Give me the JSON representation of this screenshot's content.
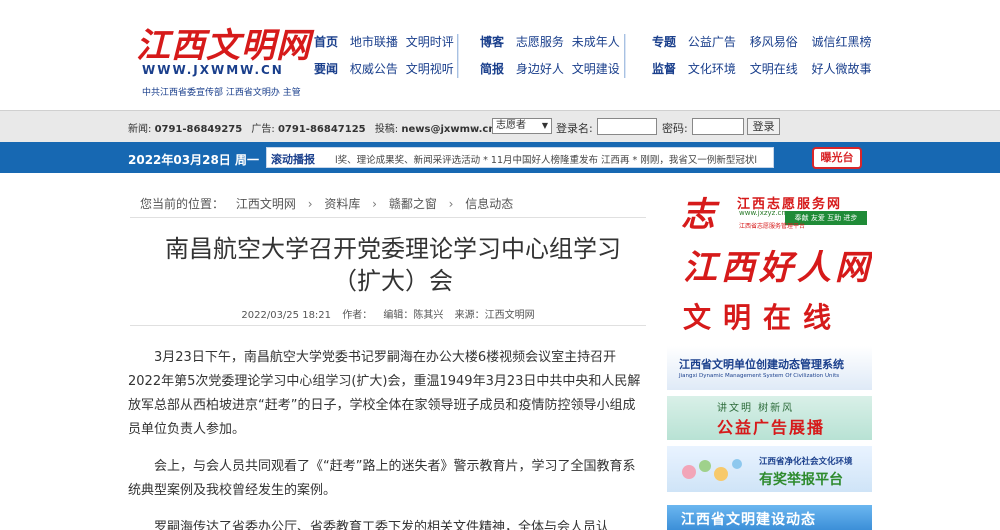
{
  "site": {
    "logo_cn": "江西文明网",
    "logo_en": "WWW.JXWMW.CN",
    "logo_sub": "中共江西省委宣传部  江西省文明办 主管"
  },
  "nav": {
    "group1": {
      "row1": {
        "head": "首页",
        "links": [
          "地市联播",
          "文明时评"
        ]
      },
      "row2": {
        "head": "要闻",
        "links": [
          "权威公告",
          "文明视听"
        ]
      }
    },
    "group2": {
      "row1": {
        "head": "博客",
        "links": [
          "志愿服务",
          "未成年人"
        ]
      },
      "row2": {
        "head": "简报",
        "links": [
          "身边好人",
          "文明建设"
        ]
      }
    },
    "group3": {
      "row1": {
        "head": "专题",
        "links": [
          "公益广告",
          "移风易俗",
          "诚信红黑榜"
        ]
      },
      "row2": {
        "head": "监督",
        "links": [
          "文化环境",
          "文明在线",
          "好人微故事"
        ]
      }
    }
  },
  "infobar": {
    "news_label": "新闻:",
    "news_phone": "0791-86849275",
    "ad_label": "广告:",
    "ad_phone": "0791-86847125",
    "mail_label": "投稿:",
    "mail": "news@jxwmw.cn",
    "select_value": "志愿者",
    "login_name_label": "登录名:",
    "password_label": "密码:",
    "login_button": "登录"
  },
  "bluebar": {
    "date": "2022年03月28日 周一",
    "scroll_label": "滚动播报",
    "scroll_text": "l奖、理论成果奖、新闻采评选活动 * 11月中国好人榜隆重发布 江西再 * 刚刚，我省又一例新型冠状l",
    "expose_button": "曝光台"
  },
  "breadcrumb": {
    "prefix": "您当前的位置：",
    "items": [
      "江西文明网",
      "资料库",
      "赣鄱之窗",
      "信息动态"
    ],
    "sep": "›"
  },
  "article": {
    "title": "南昌航空大学召开党委理论学习中心组学习（扩大）会",
    "date": "2022/03/25 18:21",
    "author": "作者：",
    "editor": "编辑：陈其兴",
    "source": "来源：江西文明网",
    "para1": "3月23日下午，南昌航空大学党委书记罗嗣海在办公大楼6楼视频会议室主持召开2022年第5次党委理论学习中心组学习(扩大)会，重温1949年3月23日中共中央和人民解放军总部从西柏坡进京“赶考”的日子，学校全体在家领导班子成员和疫情防控领导小组成员单位负责人参加。",
    "para2": "会上，与会人员共同观看了《“赶考”路上的迷失者》警示教育片，学习了全国教育系统典型案例及我校曾经发生的案例。",
    "para3": "罗嗣海传达了省委办公厅、省委教育工委下发的相关文件精神，全体与会人员认"
  },
  "sidebar": {
    "ad1": {
      "big": "志",
      "t1": "江西志愿服务网",
      "t2": "www.jxzyz.cn",
      "t3": "奉献 友爱 互助 进步",
      "t4": "江西省志愿服务管理平台"
    },
    "ad2": {
      "big": "江西好人网"
    },
    "ad3": {
      "big": "文明在线"
    },
    "ad4": {
      "t1": "江西省文明单位创建动态管理系统",
      "t2": "Jiangxi Dynamic Management System Of Civilization Units"
    },
    "ad5": {
      "t1": "讲文明 树新风",
      "t2": "公益广告展播"
    },
    "ad6": {
      "t1": "江西省净化社会文化环境",
      "t2": "有奖举报平台"
    },
    "ad7": {
      "t1": "江西省文明建设动态"
    }
  }
}
